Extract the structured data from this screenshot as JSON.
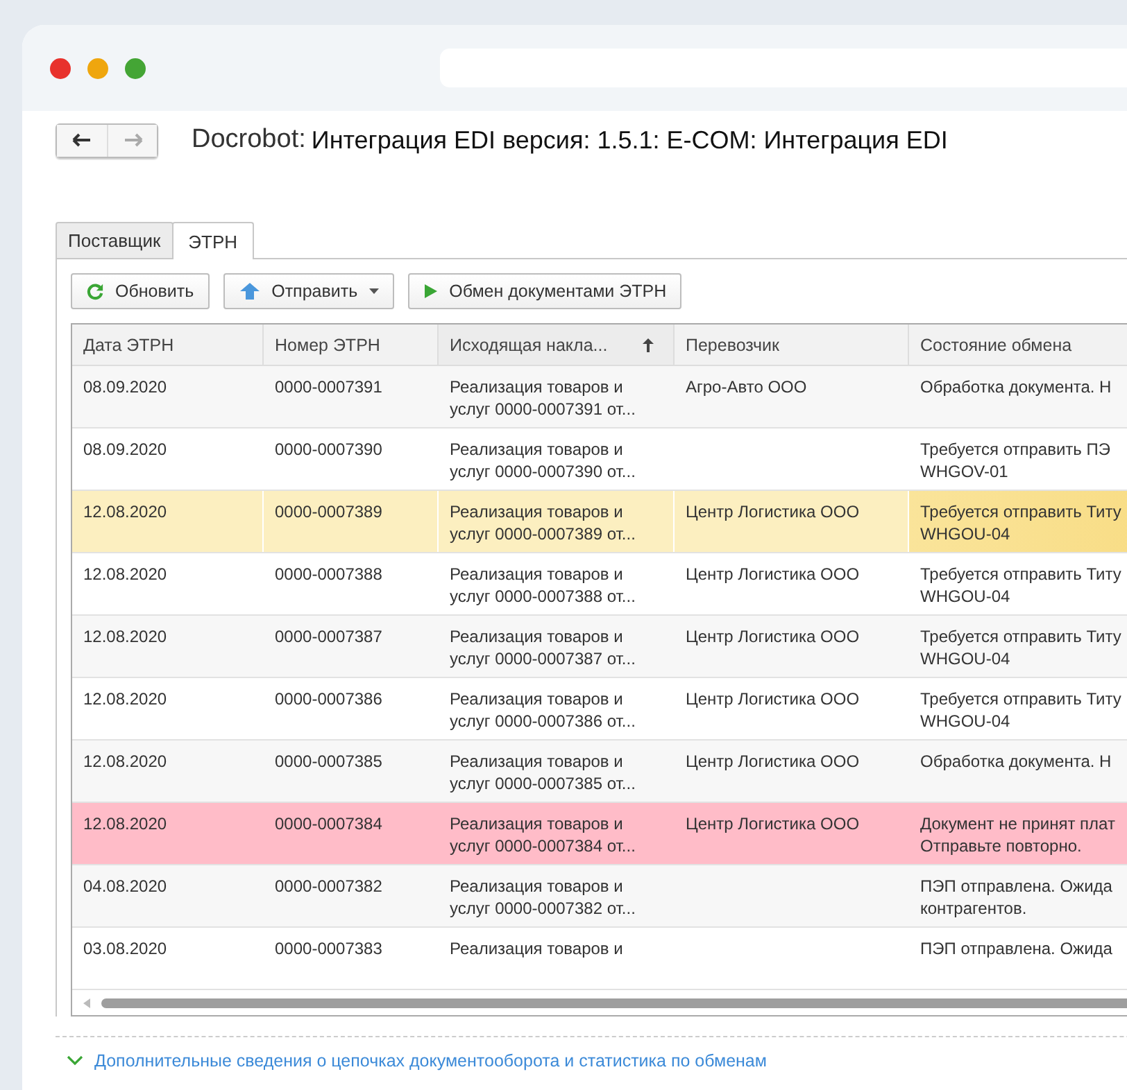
{
  "nav": {
    "back_enabled": true,
    "forward_enabled": false
  },
  "title": {
    "app": "Docrobot:",
    "text": "Интеграция EDI версия: 1.5.1: E-COM: Интеграция EDI"
  },
  "tabs": [
    {
      "label": "Поставщик",
      "selected": false
    },
    {
      "label": "ЭТРН",
      "selected": true
    }
  ],
  "toolbar": [
    {
      "kind": "refresh",
      "label": "Обновить"
    },
    {
      "kind": "send",
      "label": "Отправить"
    },
    {
      "kind": "play",
      "label": "Обмен документами ЭТРН"
    }
  ],
  "table": {
    "columns": [
      {
        "label": "Дата ЭТРН"
      },
      {
        "label": "Номер ЭТРН"
      },
      {
        "label": "Исходящая накла...",
        "sorted": true
      },
      {
        "label": "Перевозчик"
      },
      {
        "label": "Состояние обмена"
      }
    ],
    "rows": [
      {
        "date": "08.09.2020",
        "number": "0000-0007391",
        "source": [
          "Реализация товаров и",
          "услуг 0000-0007391 от..."
        ],
        "carrier": "Агро-Авто ООО",
        "status": [
          "Обработка документа. Н"
        ],
        "selected": false,
        "error": false
      },
      {
        "date": "08.09.2020",
        "number": "0000-0007390",
        "source": [
          "Реализация товаров и",
          "услуг 0000-0007390 от..."
        ],
        "status": [
          "Требуется отправить ПЭ",
          "WHGOV-01"
        ],
        "selected": false,
        "error": false
      },
      {
        "date": "12.08.2020",
        "number": "0000-0007389",
        "source": [
          "Реализация товаров и",
          "услуг 0000-0007389 от..."
        ],
        "carrier": "Центр Логистика ООО",
        "status": [
          "Требуется отправить Титу",
          "WHGOU-04"
        ],
        "selected": true,
        "error": false
      },
      {
        "date": "12.08.2020",
        "number": "0000-0007388",
        "source": [
          "Реализация товаров и",
          "услуг 0000-0007388 от..."
        ],
        "carrier": "Центр Логистика ООО",
        "status": [
          "Требуется отправить Титу",
          "WHGOU-04"
        ],
        "selected": false,
        "error": false
      },
      {
        "date": "12.08.2020",
        "number": "0000-0007387",
        "source": [
          "Реализация товаров и",
          "услуг 0000-0007387 от..."
        ],
        "carrier": "Центр Логистика ООО",
        "status": [
          "Требуется отправить Титу",
          "WHGOU-04"
        ],
        "selected": false,
        "error": false
      },
      {
        "date": "12.08.2020",
        "number": "0000-0007386",
        "source": [
          "Реализация товаров и",
          "услуг 0000-0007386 от..."
        ],
        "carrier": "Центр Логистика ООО",
        "status": [
          "Требуется отправить Титу",
          "WHGOU-04"
        ],
        "selected": false,
        "error": false
      },
      {
        "date": "12.08.2020",
        "number": "0000-0007385",
        "source": [
          "Реализация товаров и",
          "услуг 0000-0007385 от..."
        ],
        "carrier": "Центр Логистика ООО",
        "status": [
          "Обработка документа. Н"
        ],
        "selected": false,
        "error": false
      },
      {
        "date": "12.08.2020",
        "number": "0000-0007384",
        "source": [
          "Реализация товаров и",
          "услуг 0000-0007384 от..."
        ],
        "carrier": "Центр Логистика ООО",
        "status": [
          "Документ не принят плат",
          "Отправьте повторно."
        ],
        "selected": false,
        "error": true
      },
      {
        "date": "04.08.2020",
        "number": "0000-0007382",
        "source": [
          "Реализация товаров и",
          "услуг 0000-0007382 от..."
        ],
        "status": [
          "ПЭП отправлена. Ожида",
          "контрагентов."
        ],
        "selected": false,
        "error": false
      },
      {
        "date": "03.08.2020",
        "number": "0000-0007383",
        "source": [
          "Реализация товаров и"
        ],
        "status": [
          "ПЭП отправлена. Ожида"
        ],
        "selected": false,
        "error": false
      }
    ]
  },
  "footer_link": "Дополнительные сведения о цепочках документооборота и статистика по обменам"
}
